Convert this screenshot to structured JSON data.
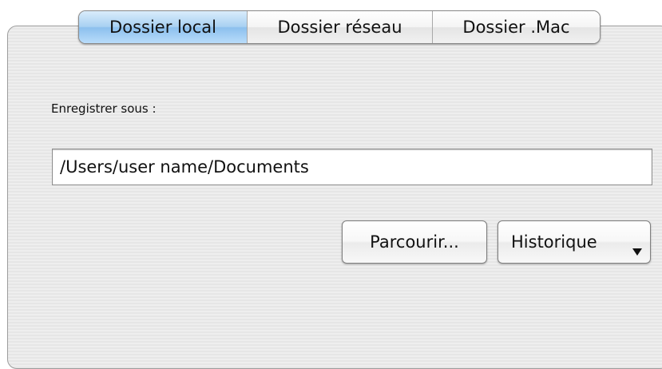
{
  "tabs": [
    {
      "label": "Dossier local",
      "selected": true
    },
    {
      "label": "Dossier réseau",
      "selected": false
    },
    {
      "label": "Dossier .Mac",
      "selected": false
    }
  ],
  "form": {
    "save_label": "Enregistrer sous :",
    "path_value": "/Users/user name/Documents"
  },
  "buttons": {
    "browse_label": "Parcourir...",
    "history_label": "Historique"
  },
  "icons": {
    "history_dropdown": "triangle-down-icon"
  },
  "colors": {
    "active_tab": "#a9d1f2",
    "panel_background": "#ebebeb"
  }
}
